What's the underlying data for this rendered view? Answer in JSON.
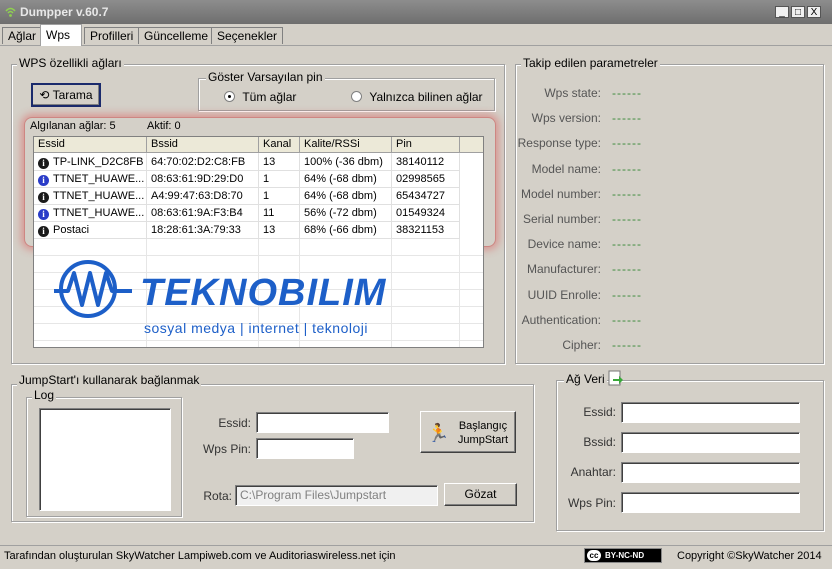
{
  "window": {
    "title": "Dumpper v.60.7",
    "min": "_",
    "max": "□",
    "close": "X"
  },
  "tabs": [
    "Ağlar",
    "Wps",
    "Profilleri",
    "Güncelleme",
    "Seçenekler"
  ],
  "wps_group": {
    "title": "WPS özellikli ağları",
    "scan_button": "Tarama",
    "show_pin_title": "Göster Varsayılan pin",
    "radio_all": "Tüm ağlar",
    "radio_known": "Yalnızca bilinen ağlar",
    "detected_label": "Algılanan ağlar: 5",
    "active_label": "Aktif: 0",
    "columns": [
      "Essid",
      "Bssid",
      "Kanal",
      "Kalite/RSSi",
      "Pin"
    ],
    "rows": [
      {
        "essid": "TP-LINK_D2C8FB",
        "bssid": "64:70:02:D2:C8:FB",
        "kanal": "13",
        "kalite": "100% (-36 dbm)",
        "pin": "38140112",
        "icon_color": "#1a1a1a"
      },
      {
        "essid": "TTNET_HUAWE...",
        "bssid": "08:63:61:9D:29:D0",
        "kanal": "1",
        "kalite": "64% (-68 dbm)",
        "pin": "02998565",
        "icon_color": "#2a3cc8"
      },
      {
        "essid": "TTNET_HUAWE...",
        "bssid": "A4:99:47:63:D8:70",
        "kanal": "1",
        "kalite": "64% (-68 dbm)",
        "pin": "65434727",
        "icon_color": "#1a1a1a"
      },
      {
        "essid": "TTNET_HUAWE...",
        "bssid": "08:63:61:9A:F3:B4",
        "kanal": "11",
        "kalite": "56% (-72 dbm)",
        "pin": "01549324",
        "icon_color": "#2a3cc8"
      },
      {
        "essid": "Postaci",
        "bssid": "18:28:61:3A:79:33",
        "kanal": "13",
        "kalite": "68% (-66 dbm)",
        "pin": "38321153",
        "icon_color": "#1a1a1a"
      }
    ]
  },
  "watermark": {
    "brand": "TEKNOBILIM",
    "tagline": "sosyal medya | internet | teknoloji"
  },
  "params": {
    "title": "Takip edilen parametreler",
    "items": [
      {
        "label": "Wps state:",
        "value": "------"
      },
      {
        "label": "Wps version:",
        "value": "------"
      },
      {
        "label": "Response type:",
        "value": "------"
      },
      {
        "label": "Model name:",
        "value": "------"
      },
      {
        "label": "Model number:",
        "value": "------"
      },
      {
        "label": "Serial number:",
        "value": "------"
      },
      {
        "label": "Device name:",
        "value": "------"
      },
      {
        "label": "Manufacturer:",
        "value": "------"
      },
      {
        "label": "UUID Enrolle:",
        "value": "------"
      },
      {
        "label": "Authentication:",
        "value": "------"
      },
      {
        "label": "Cipher:",
        "value": "------"
      }
    ]
  },
  "jumpstart": {
    "title": "JumpStart'ı kullanarak bağlanmak",
    "log": "Log",
    "essid_label": "Essid:",
    "essid_value": "",
    "pin_label": "Wps Pin:",
    "pin_value": "",
    "start_button_line1": "Başlangıç",
    "start_button_line2": "JumpStart",
    "path_label": "Rota:",
    "path_value": "C:\\Program Files\\Jumpstart",
    "browse_button": "Gözat"
  },
  "net_data": {
    "title": "Ağ Veri",
    "essid": "Essid:",
    "bssid": "Bssid:",
    "key": "Anahtar:",
    "pin": "Wps Pin:"
  },
  "status": {
    "left": "Tarafından oluşturulan SkyWatcher Lampiweb.com ve Auditoriaswireless.net için",
    "cc_badge": "BY-NC-ND",
    "right": "Copyright ©SkyWatcher 2014"
  },
  "colors": {
    "accent": "#2a3cc8",
    "param_value": "#3a8a3a",
    "watermark": "#1d5fc8"
  }
}
